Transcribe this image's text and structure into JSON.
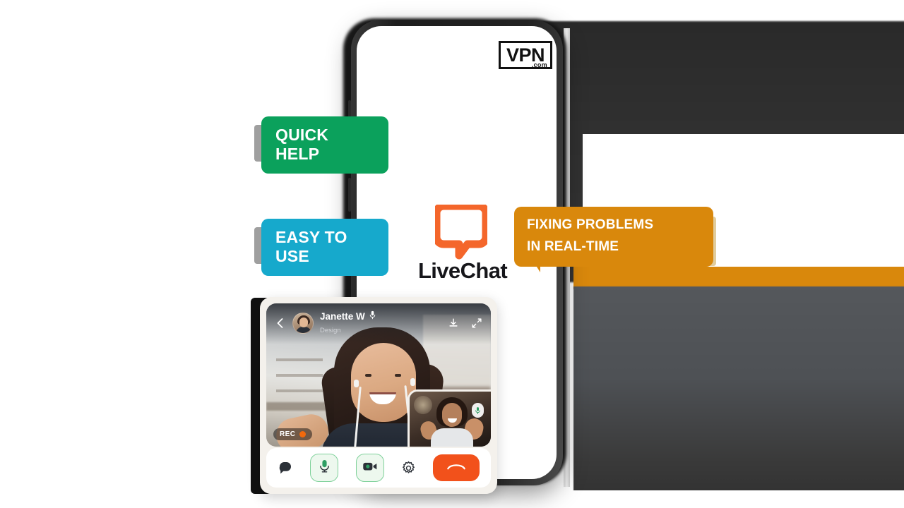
{
  "brand": {
    "logo_text": "VPN",
    "logo_suffix": ".com",
    "logo_name": "vpn-dot-com-logo"
  },
  "product": {
    "name": "LiveChat",
    "mark_name": "livechat-speech-bubble-icon",
    "accent_color": "#F4662B"
  },
  "bubbles": [
    {
      "id": "quick-help",
      "text": "QUICK HELP",
      "color": "#0BA15C",
      "tail": "bottom-right"
    },
    {
      "id": "easy-to-use",
      "text": "EASY TO USE",
      "color": "#16A9CC",
      "tail": "bottom-right"
    },
    {
      "id": "fixing",
      "line1": "FIXING PROBLEMS",
      "line2": "IN REAL-TIME",
      "color": "#D9880C",
      "tail": "bottom-left"
    }
  ],
  "call": {
    "contact_name": "Janette W",
    "contact_role": "Design",
    "mic_status_icon": "microphone-icon",
    "back_icon": "chevron-left-icon",
    "download_icon": "download-icon",
    "expand_icon": "expand-arrows-icon",
    "recording_label": "REC",
    "recording_dot_color": "#F2690D",
    "pip_mic_icon": "microphone-icon",
    "controls": [
      {
        "id": "chat",
        "icon": "chat-bubble-icon",
        "label": "Chat"
      },
      {
        "id": "microphone",
        "icon": "microphone-icon",
        "label": "Microphone",
        "state": "on",
        "accent": "#7FD19A"
      },
      {
        "id": "camera",
        "icon": "video-camera-icon",
        "label": "Camera",
        "state": "on",
        "accent": "#7FD19A"
      },
      {
        "id": "settings",
        "icon": "gear-icon",
        "label": "Settings"
      },
      {
        "id": "end-call",
        "icon": "phone-hangup-icon",
        "label": "End call",
        "accent": "#F2511B"
      }
    ]
  },
  "device": {
    "name": "smartphone-mockup"
  }
}
